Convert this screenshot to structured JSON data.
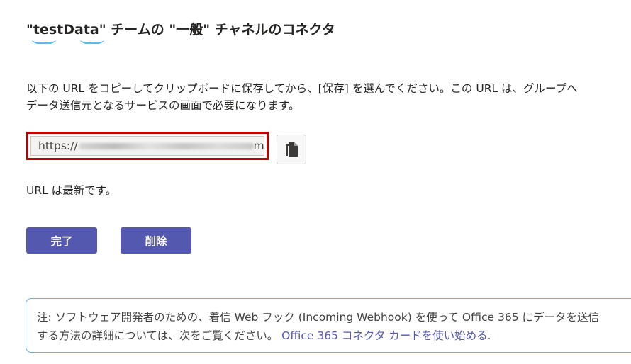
{
  "header": {
    "title": "\"testData\" チームの \"一般\" チャネルのコネクタ"
  },
  "instructions": {
    "line1": "以下の URL をコピーしてクリップボードに保存してから、[保存] を選んでください。この URL は、グループへ",
    "line2": "データ送信元となるサービスの画面で必要になります。"
  },
  "webhook_url": {
    "prefix": "https://",
    "suffix": "m/\\"
  },
  "copy_button": {
    "icon": "copy-icon"
  },
  "status": {
    "text": "URL は最新です。"
  },
  "actions": {
    "done_label": "完了",
    "delete_label": "削除"
  },
  "note": {
    "line1": "注: ソフトウェア開発者のための、着信 Web フック (Incoming Webhook) を使って Office 365 にデータを送信",
    "line2_text": "する方法の詳細については、次をご覧ください。 ",
    "link_label": "Office 365 コネクタ カードを使い始める."
  },
  "colors": {
    "primary_button": "#5558af",
    "highlight_border": "#c00000",
    "note_border": "#6aaee0",
    "link": "#5558af"
  }
}
